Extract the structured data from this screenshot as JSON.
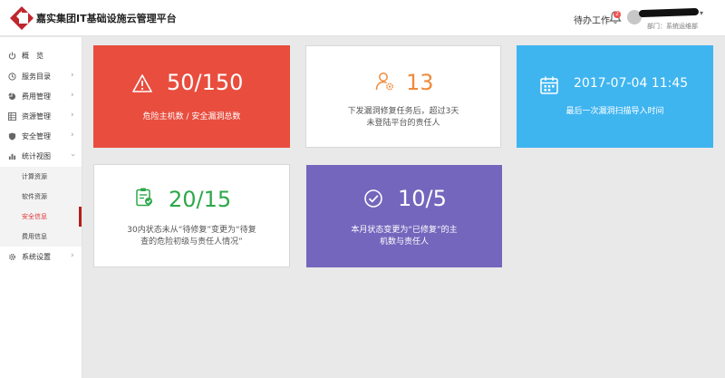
{
  "header": {
    "app_title": "嘉实集团IT基础设施云管理平台",
    "todo_label": "待办工作",
    "notification_count": "2",
    "department": "部门：系统运维部"
  },
  "sidebar": {
    "items": [
      {
        "label": "概　览",
        "icon": "power-icon"
      },
      {
        "label": "服务目录",
        "icon": "clock-icon"
      },
      {
        "label": "费用管理",
        "icon": "pie-icon"
      },
      {
        "label": "资源管理",
        "icon": "grid-icon"
      },
      {
        "label": "安全管理",
        "icon": "shield-icon"
      },
      {
        "label": "统计视图",
        "icon": "bar-chart-icon"
      },
      {
        "label": "系统设置",
        "icon": "gear-icon"
      }
    ],
    "sub_items": [
      {
        "label": "计算资源"
      },
      {
        "label": "软件资源"
      },
      {
        "label": "安全信息",
        "active": true
      },
      {
        "label": "费用信息"
      }
    ]
  },
  "cards": {
    "hosts": {
      "value": "50/150",
      "desc": "危险主机数 / 安全漏洞总数",
      "icon": "warning-triangle-icon",
      "color": "#e84d3e"
    },
    "owners": {
      "value": "13",
      "desc_line1": "下发漏洞修复任务后，超过3天",
      "desc_line2": "未登陆平台的责任人",
      "icon": "user-gear-icon",
      "color": "#f08a3c"
    },
    "scan": {
      "value": "2017-07-04 11:45",
      "desc": "最后一次漏洞扫描导入时间",
      "icon": "calendar-icon",
      "color": "#3fb5f0"
    },
    "pending": {
      "value": "20/15",
      "desc_line1": "30内状态未从“待修复”变更为“待复",
      "desc_line2": "查的危险初级与责任人情况”",
      "icon": "clipboard-check-icon",
      "color": "#2ea84a"
    },
    "fixed": {
      "value": "10/5",
      "desc_line1": "本月状态变更为“已修复”的主",
      "desc_line2": "机数与责任人",
      "icon": "check-circle-icon",
      "color": "#7466bd"
    }
  }
}
